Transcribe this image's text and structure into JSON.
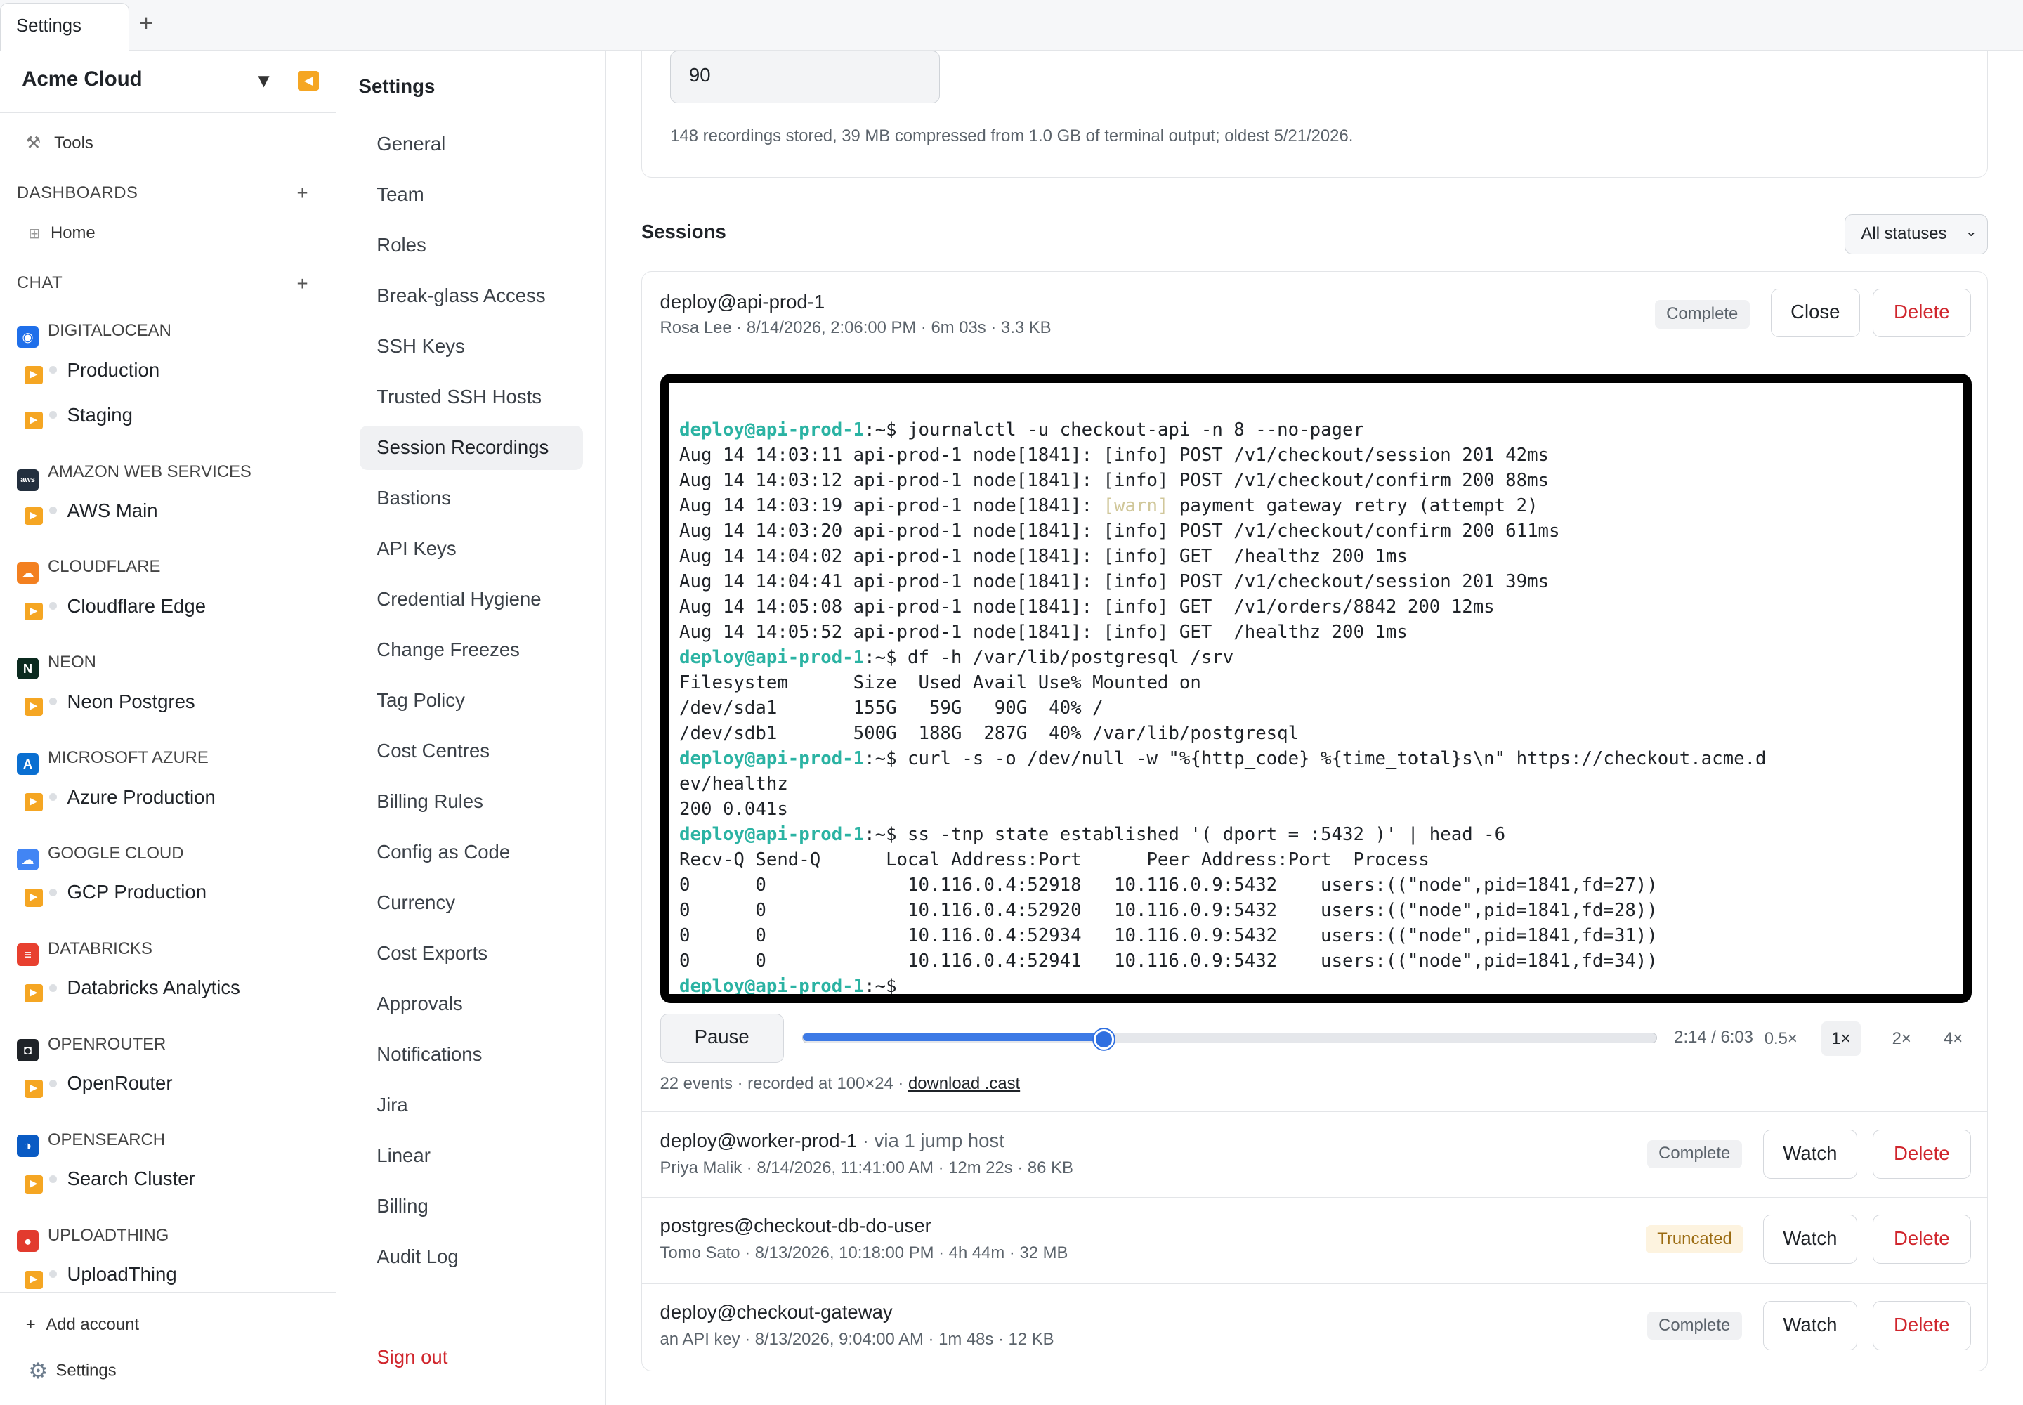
{
  "tabbar": {
    "tab_label": "Settings",
    "new_tab": "+"
  },
  "sidebar": {
    "org_name": "Acme Cloud",
    "tools_label": "Tools",
    "dashboards_label": "DASHBOARDS",
    "home_label": "Home",
    "chat_label": "CHAT",
    "providers": [
      {
        "name": "DIGITALOCEAN",
        "color": "#1f6fea",
        "accounts": [
          "Production",
          "Staging"
        ]
      },
      {
        "name": "AMAZON WEB SERVICES",
        "color": "#232f3e",
        "accounts": [
          "AWS Main"
        ]
      },
      {
        "name": "CLOUDFLARE",
        "color": "#f38020",
        "accounts": [
          "Cloudflare Edge"
        ]
      },
      {
        "name": "NEON",
        "color": "#0b2a1f",
        "accounts": [
          "Neon Postgres"
        ]
      },
      {
        "name": "MICROSOFT AZURE",
        "color": "#0a6fd1",
        "accounts": [
          "Azure Production"
        ]
      },
      {
        "name": "GOOGLE CLOUD",
        "color": "#4285f4",
        "accounts": [
          "GCP Production"
        ]
      },
      {
        "name": "DATABRICKS",
        "color": "#e8402f",
        "accounts": [
          "Databricks Analytics"
        ]
      },
      {
        "name": "OPENROUTER",
        "color": "#1f2328",
        "accounts": [
          "OpenRouter"
        ]
      },
      {
        "name": "OPENSEARCH",
        "color": "#0a5bc4",
        "accounts": [
          "Search Cluster"
        ]
      },
      {
        "name": "UPLOADTHING",
        "color": "#e23b2e",
        "accounts": [
          "UploadThing"
        ]
      }
    ],
    "add_account": "Add account",
    "settings_label": "Settings"
  },
  "settings_nav": {
    "title": "Settings",
    "items": [
      "General",
      "Team",
      "Roles",
      "Break-glass Access",
      "SSH Keys",
      "Trusted SSH Hosts",
      "Session Recordings",
      "Bastions",
      "API Keys",
      "Credential Hygiene",
      "Change Freezes",
      "Tag Policy",
      "Cost Centres",
      "Billing Rules",
      "Config as Code",
      "Currency",
      "Cost Exports",
      "Approvals",
      "Notifications",
      "Jira",
      "Linear",
      "Billing",
      "Audit Log"
    ],
    "active": "Session Recordings",
    "sign_out": "Sign out"
  },
  "retention": {
    "value": "90",
    "help": "148 recordings stored, 39 MB compressed from 1.0 GB of terminal output; oldest 5/21/2026."
  },
  "sessions": {
    "title": "Sessions",
    "filter": "All statuses",
    "expanded": {
      "title": "deploy@api-prod-1",
      "meta": "Rosa Lee · 8/14/2026, 2:06:00 PM · 6m 03s · 3.3 KB",
      "status": "Complete",
      "close_label": "Close",
      "delete_label": "Delete",
      "terminal_lines": [
        {
          "prompt": "deploy@api-prod-1",
          "sep": ":~$ ",
          "text": "journalctl -u checkout-api -n 8 --no-pager"
        },
        {
          "text": "Aug 14 14:03:11 api-prod-1 node[1841]: [info] POST /v1/checkout/session 201 42ms"
        },
        {
          "text": "Aug 14 14:03:12 api-prod-1 node[1841]: [info] POST /v1/checkout/confirm 200 88ms"
        },
        {
          "pre": "Aug 14 14:03:19 api-prod-1 node[1841]: ",
          "warn": "[warn]",
          "text": " payment gateway retry (attempt 2)"
        },
        {
          "text": "Aug 14 14:03:20 api-prod-1 node[1841]: [info] POST /v1/checkout/confirm 200 611ms"
        },
        {
          "text": "Aug 14 14:04:02 api-prod-1 node[1841]: [info] GET  /healthz 200 1ms"
        },
        {
          "text": "Aug 14 14:04:41 api-prod-1 node[1841]: [info] POST /v1/checkout/session 201 39ms"
        },
        {
          "text": "Aug 14 14:05:08 api-prod-1 node[1841]: [info] GET  /v1/orders/8842 200 12ms"
        },
        {
          "text": "Aug 14 14:05:52 api-prod-1 node[1841]: [info] GET  /healthz 200 1ms"
        },
        {
          "prompt": "deploy@api-prod-1",
          "sep": ":~$ ",
          "text": "df -h /var/lib/postgresql /srv"
        },
        {
          "text": "Filesystem      Size  Used Avail Use% Mounted on"
        },
        {
          "text": "/dev/sda1       155G   59G   90G  40% /"
        },
        {
          "text": "/dev/sdb1       500G  188G  287G  40% /var/lib/postgresql"
        },
        {
          "prompt": "deploy@api-prod-1",
          "sep": ":~$ ",
          "text": "curl -s -o /dev/null -w \"%{http_code} %{time_total}s\\n\" https://checkout.acme.d"
        },
        {
          "text": "ev/healthz"
        },
        {
          "text": "200 0.041s"
        },
        {
          "prompt": "deploy@api-prod-1",
          "sep": ":~$ ",
          "text": "ss -tnp state established '( dport = :5432 )' | head -6"
        },
        {
          "text": "Recv-Q Send-Q      Local Address:Port      Peer Address:Port  Process"
        },
        {
          "text": "0      0             10.116.0.4:52918   10.116.0.9:5432    users:((\"node\",pid=1841,fd=27))"
        },
        {
          "text": "0      0             10.116.0.4:52920   10.116.0.9:5432    users:((\"node\",pid=1841,fd=28))"
        },
        {
          "text": "0      0             10.116.0.4:52934   10.116.0.9:5432    users:((\"node\",pid=1841,fd=31))"
        },
        {
          "text": "0      0             10.116.0.4:52941   10.116.0.9:5432    users:((\"node\",pid=1841,fd=34))"
        },
        {
          "prompt": "deploy@api-prod-1",
          "sep": ":~$",
          "text": ""
        }
      ],
      "player": {
        "pause_label": "Pause",
        "progress": 0.3526,
        "time": "2:14 / 6:03",
        "speeds": [
          "0.5×",
          "1×",
          "2×",
          "4×"
        ],
        "active_speed": "1×",
        "footer_text": "22 events · recorded at 100×24 · ",
        "download_label": "download .cast"
      }
    },
    "rows": [
      {
        "title": "deploy@worker-prod-1",
        "via": " · via 1 jump host",
        "meta": "Priya Malik · 8/14/2026, 11:41:00 AM · 12m 22s · 86 KB",
        "status": "Complete",
        "watch_label": "Watch",
        "delete_label": "Delete"
      },
      {
        "title": "postgres@checkout-db-do-user",
        "via": "",
        "meta": "Tomo Sato · 8/13/2026, 10:18:00 PM · 4h 44m · 32 MB",
        "status": "Truncated",
        "watch_label": "Watch",
        "delete_label": "Delete"
      },
      {
        "title": "deploy@checkout-gateway",
        "via": "",
        "meta": "an API key · 8/13/2026, 9:04:00 AM · 1m 48s · 12 KB",
        "status": "Complete",
        "watch_label": "Watch",
        "delete_label": "Delete"
      }
    ]
  }
}
